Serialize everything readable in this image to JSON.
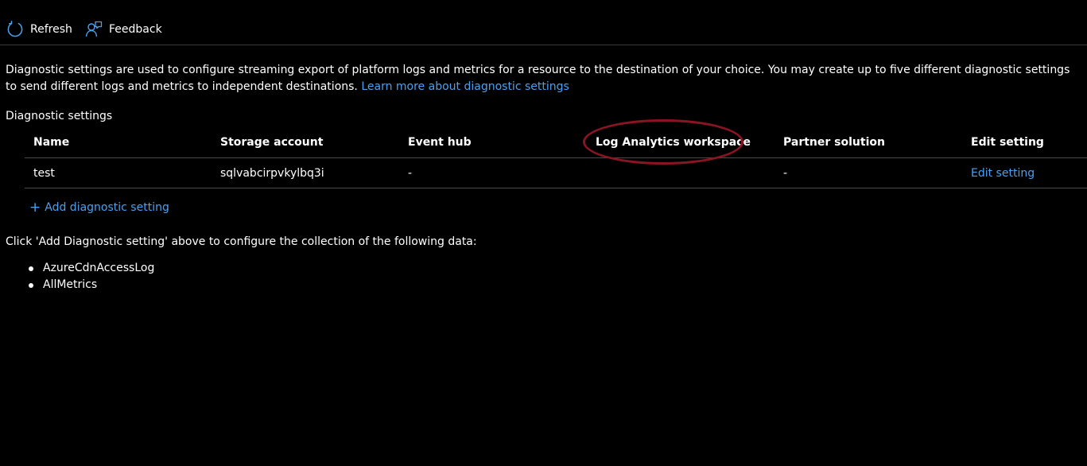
{
  "toolbar": {
    "refresh_label": "Refresh",
    "feedback_label": "Feedback",
    "refresh_icon": "refresh-icon",
    "feedback_icon": "feedback-icon"
  },
  "description": {
    "text": "Diagnostic settings are used to configure streaming export of platform logs and metrics for a resource to the destination of your choice. You may create up to five different diagnostic settings to send different logs and metrics to independent destinations.",
    "link_text": "Learn more about diagnostic settings"
  },
  "section_label": "Diagnostic settings",
  "table": {
    "columns": [
      "Name",
      "Storage account",
      "Event hub",
      "Log Analytics workspace",
      "Partner solution",
      "Edit setting"
    ],
    "rows": [
      {
        "name": "test",
        "storage_account": "sqlvabcirpvkylbq3i",
        "event_hub": "-",
        "log_analytics": "",
        "partner_solution": "-",
        "edit_setting": "Edit setting"
      }
    ]
  },
  "add_setting_label": "Add diagnostic setting",
  "instructions": "Click 'Add Diagnostic setting' above to configure the collection of the following data:",
  "data_items": [
    "AzureCdnAccessLog",
    "AllMetrics"
  ],
  "colors": {
    "link": "#4ba0f0",
    "annotation": "#8b1424",
    "background": "#000000"
  }
}
